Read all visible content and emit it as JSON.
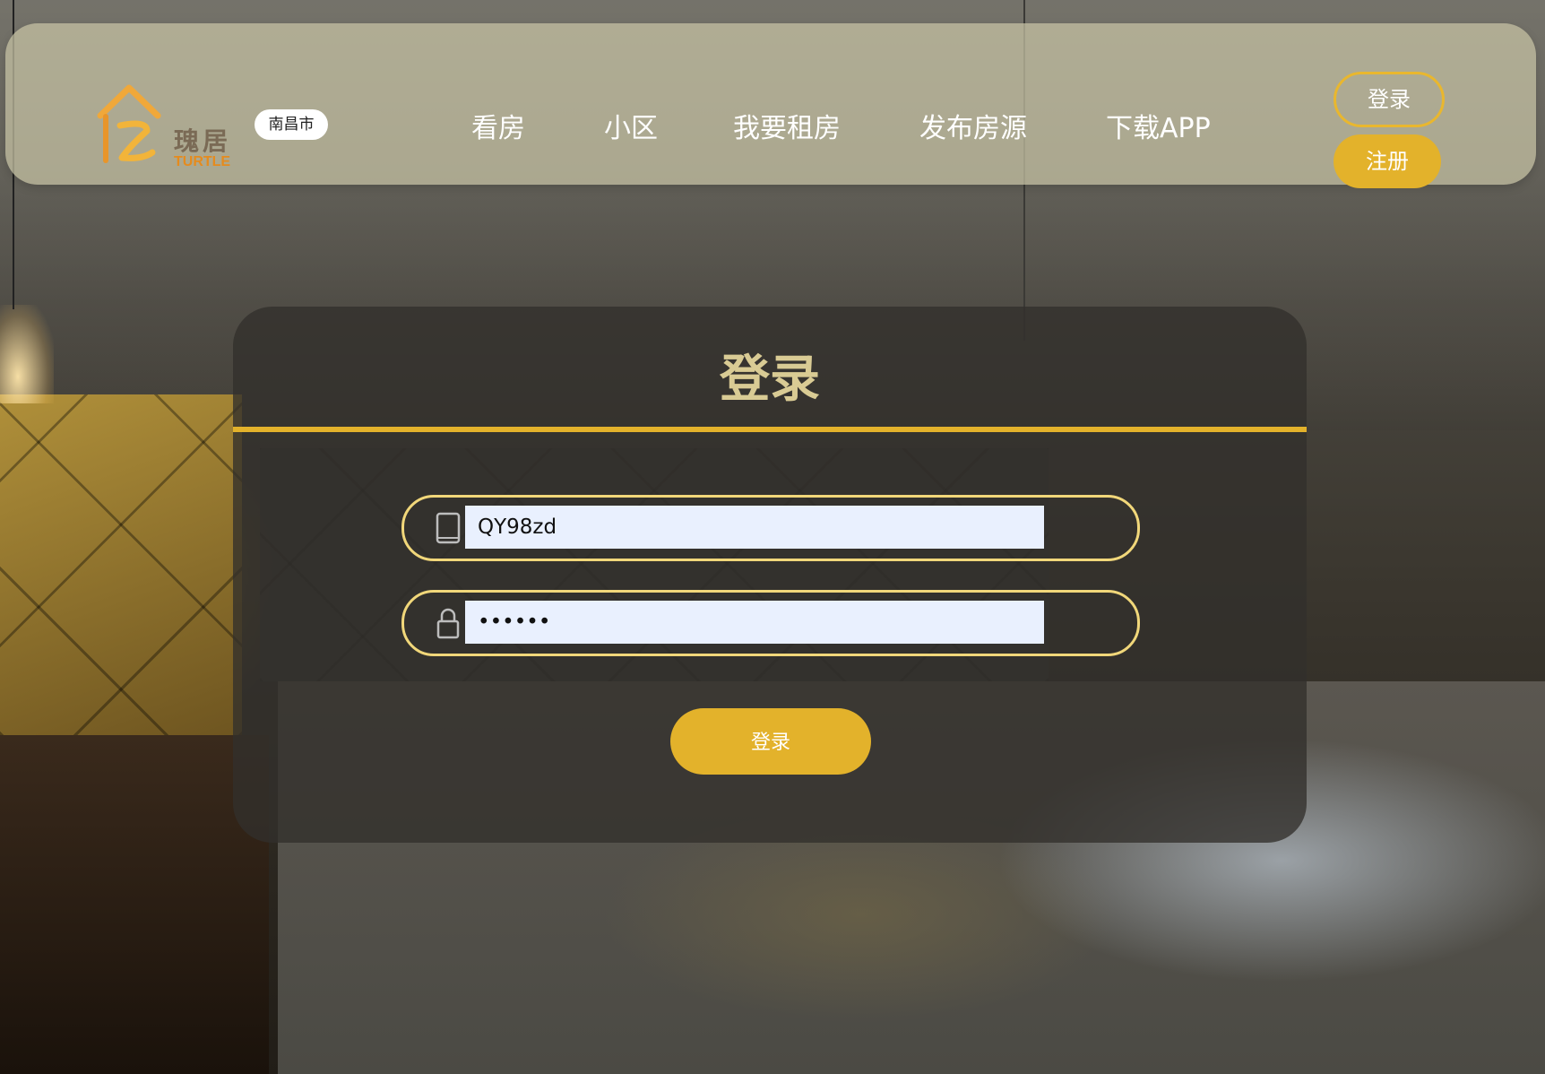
{
  "header": {
    "logo_text": "瑰居",
    "logo_sub": "TURTLE",
    "city": "南昌市",
    "nav": [
      "看房",
      "小区",
      "我要租房",
      "发布房源",
      "下载APP"
    ],
    "login_label": "登录",
    "register_label": "注册"
  },
  "login": {
    "title": "登录",
    "username_value": "QY98zd",
    "password_value": "••••••",
    "submit_label": "登录"
  },
  "colors": {
    "accent": "#e3b22b",
    "field_border": "#f1d77a",
    "title": "#d9cb94"
  }
}
